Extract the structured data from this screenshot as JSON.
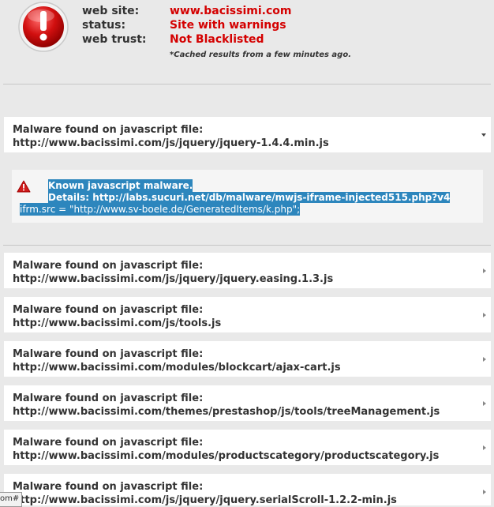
{
  "summary": {
    "icon": "alert-exclamation-icon",
    "rows": [
      {
        "key": "web site:",
        "value": "www.bacissimi.com"
      },
      {
        "key": "status:",
        "value": "Site with warnings"
      },
      {
        "key": "web trust:",
        "value": "Not Blacklisted"
      }
    ],
    "cache_note": "*Cached results from a few minutes ago."
  },
  "colors": {
    "warning_red": "#d40000",
    "selection_blue": "#2d86bd",
    "panel_bg": "#ffffff",
    "page_bg": "#e9e9e9"
  },
  "expanded_panel": {
    "title": "Malware found on javascript file:",
    "url": "http://www.bacissimi.com/js/jquery/jquery-1.4.4.min.js",
    "expanded": true,
    "detail": {
      "icon": "warning-triangle-icon",
      "line1": "Known javascript malware.",
      "line2_label": "Details:",
      "line2_link_selected": "http://labs.sucuri.net/db/malware/mwjs-iframe-injected515",
      "line2_link_rest": ".php?v4",
      "line3": "ifrm.src = \"http://www.sv-boele.de/GeneratedItems/k.php\";"
    }
  },
  "panels": [
    {
      "title": "Malware found on javascript file:",
      "url": "http://www.bacissimi.com/js/jquery/jquery.easing.1.3.js"
    },
    {
      "title": "Malware found on javascript file:",
      "url": "http://www.bacissimi.com/js/tools.js"
    },
    {
      "title": "Malware found on javascript file:",
      "url": "http://www.bacissimi.com/modules/blockcart/ajax-cart.js"
    },
    {
      "title": "Malware found on javascript file:",
      "url": "http://www.bacissimi.com/themes/prestashop/js/tools/treeManagement.js"
    },
    {
      "title": "Malware found on javascript file:",
      "url": "http://www.bacissimi.com/modules/productscategory/productscategory.js"
    },
    {
      "title": "Malware found on javascript file:",
      "url": "http://www.bacissimi.com/js/jquery/jquery.serialScroll-1.2.2-min.js"
    }
  ],
  "status_bar": {
    "text": "om#"
  }
}
